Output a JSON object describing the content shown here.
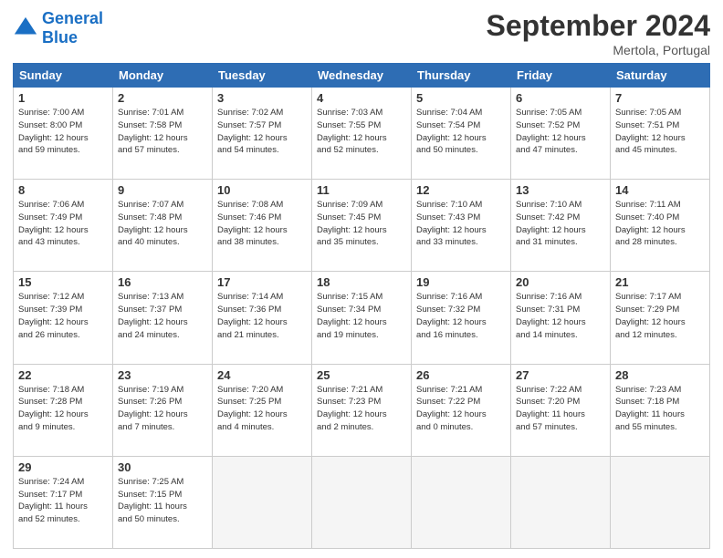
{
  "header": {
    "logo_general": "General",
    "logo_blue": "Blue",
    "month_title": "September 2024",
    "subtitle": "Mertola, Portugal"
  },
  "days_of_week": [
    "Sunday",
    "Monday",
    "Tuesday",
    "Wednesday",
    "Thursday",
    "Friday",
    "Saturday"
  ],
  "weeks": [
    [
      {
        "num": "1",
        "info": "Sunrise: 7:00 AM\nSunset: 8:00 PM\nDaylight: 12 hours\nand 59 minutes."
      },
      {
        "num": "2",
        "info": "Sunrise: 7:01 AM\nSunset: 7:58 PM\nDaylight: 12 hours\nand 57 minutes."
      },
      {
        "num": "3",
        "info": "Sunrise: 7:02 AM\nSunset: 7:57 PM\nDaylight: 12 hours\nand 54 minutes."
      },
      {
        "num": "4",
        "info": "Sunrise: 7:03 AM\nSunset: 7:55 PM\nDaylight: 12 hours\nand 52 minutes."
      },
      {
        "num": "5",
        "info": "Sunrise: 7:04 AM\nSunset: 7:54 PM\nDaylight: 12 hours\nand 50 minutes."
      },
      {
        "num": "6",
        "info": "Sunrise: 7:05 AM\nSunset: 7:52 PM\nDaylight: 12 hours\nand 47 minutes."
      },
      {
        "num": "7",
        "info": "Sunrise: 7:05 AM\nSunset: 7:51 PM\nDaylight: 12 hours\nand 45 minutes."
      }
    ],
    [
      {
        "num": "8",
        "info": "Sunrise: 7:06 AM\nSunset: 7:49 PM\nDaylight: 12 hours\nand 43 minutes."
      },
      {
        "num": "9",
        "info": "Sunrise: 7:07 AM\nSunset: 7:48 PM\nDaylight: 12 hours\nand 40 minutes."
      },
      {
        "num": "10",
        "info": "Sunrise: 7:08 AM\nSunset: 7:46 PM\nDaylight: 12 hours\nand 38 minutes."
      },
      {
        "num": "11",
        "info": "Sunrise: 7:09 AM\nSunset: 7:45 PM\nDaylight: 12 hours\nand 35 minutes."
      },
      {
        "num": "12",
        "info": "Sunrise: 7:10 AM\nSunset: 7:43 PM\nDaylight: 12 hours\nand 33 minutes."
      },
      {
        "num": "13",
        "info": "Sunrise: 7:10 AM\nSunset: 7:42 PM\nDaylight: 12 hours\nand 31 minutes."
      },
      {
        "num": "14",
        "info": "Sunrise: 7:11 AM\nSunset: 7:40 PM\nDaylight: 12 hours\nand 28 minutes."
      }
    ],
    [
      {
        "num": "15",
        "info": "Sunrise: 7:12 AM\nSunset: 7:39 PM\nDaylight: 12 hours\nand 26 minutes."
      },
      {
        "num": "16",
        "info": "Sunrise: 7:13 AM\nSunset: 7:37 PM\nDaylight: 12 hours\nand 24 minutes."
      },
      {
        "num": "17",
        "info": "Sunrise: 7:14 AM\nSunset: 7:36 PM\nDaylight: 12 hours\nand 21 minutes."
      },
      {
        "num": "18",
        "info": "Sunrise: 7:15 AM\nSunset: 7:34 PM\nDaylight: 12 hours\nand 19 minutes."
      },
      {
        "num": "19",
        "info": "Sunrise: 7:16 AM\nSunset: 7:32 PM\nDaylight: 12 hours\nand 16 minutes."
      },
      {
        "num": "20",
        "info": "Sunrise: 7:16 AM\nSunset: 7:31 PM\nDaylight: 12 hours\nand 14 minutes."
      },
      {
        "num": "21",
        "info": "Sunrise: 7:17 AM\nSunset: 7:29 PM\nDaylight: 12 hours\nand 12 minutes."
      }
    ],
    [
      {
        "num": "22",
        "info": "Sunrise: 7:18 AM\nSunset: 7:28 PM\nDaylight: 12 hours\nand 9 minutes."
      },
      {
        "num": "23",
        "info": "Sunrise: 7:19 AM\nSunset: 7:26 PM\nDaylight: 12 hours\nand 7 minutes."
      },
      {
        "num": "24",
        "info": "Sunrise: 7:20 AM\nSunset: 7:25 PM\nDaylight: 12 hours\nand 4 minutes."
      },
      {
        "num": "25",
        "info": "Sunrise: 7:21 AM\nSunset: 7:23 PM\nDaylight: 12 hours\nand 2 minutes."
      },
      {
        "num": "26",
        "info": "Sunrise: 7:21 AM\nSunset: 7:22 PM\nDaylight: 12 hours\nand 0 minutes."
      },
      {
        "num": "27",
        "info": "Sunrise: 7:22 AM\nSunset: 7:20 PM\nDaylight: 11 hours\nand 57 minutes."
      },
      {
        "num": "28",
        "info": "Sunrise: 7:23 AM\nSunset: 7:18 PM\nDaylight: 11 hours\nand 55 minutes."
      }
    ],
    [
      {
        "num": "29",
        "info": "Sunrise: 7:24 AM\nSunset: 7:17 PM\nDaylight: 11 hours\nand 52 minutes."
      },
      {
        "num": "30",
        "info": "Sunrise: 7:25 AM\nSunset: 7:15 PM\nDaylight: 11 hours\nand 50 minutes."
      },
      {
        "num": "",
        "info": ""
      },
      {
        "num": "",
        "info": ""
      },
      {
        "num": "",
        "info": ""
      },
      {
        "num": "",
        "info": ""
      },
      {
        "num": "",
        "info": ""
      }
    ]
  ]
}
